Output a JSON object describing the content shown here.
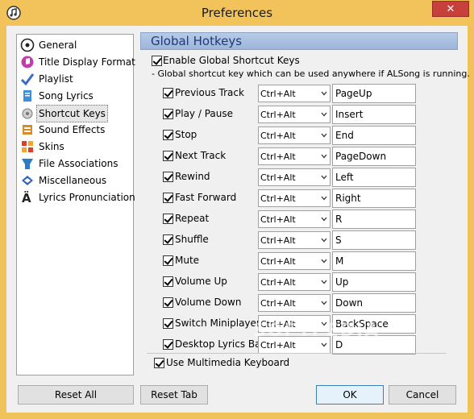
{
  "window": {
    "title": "Preferences",
    "close_label": "✕"
  },
  "sidebar": {
    "items": [
      {
        "label": "General",
        "icon": "general-icon",
        "selected": false
      },
      {
        "label": "Title Display Format",
        "icon": "title-format-icon",
        "selected": false
      },
      {
        "label": "Playlist",
        "icon": "playlist-icon",
        "selected": false
      },
      {
        "label": "Song Lyrics",
        "icon": "lyrics-icon",
        "selected": false
      },
      {
        "label": "Shortcut Keys",
        "icon": "shortcut-keys-icon",
        "selected": true
      },
      {
        "label": "Sound Effects",
        "icon": "sound-effects-icon",
        "selected": false
      },
      {
        "label": "Skins",
        "icon": "skins-icon",
        "selected": false
      },
      {
        "label": "File Associations",
        "icon": "file-associations-icon",
        "selected": false
      },
      {
        "label": "Miscellaneous",
        "icon": "miscellaneous-icon",
        "selected": false
      },
      {
        "label": "Lyrics Pronunciation",
        "icon": "pronunciation-icon",
        "selected": false
      }
    ]
  },
  "panel": {
    "header": "Global Hotkeys",
    "enable_label": "Enable Global Shortcut Keys",
    "enable_checked": true,
    "description": "- Global shortcut key which can be used anywhere if ALSong is running.",
    "hotkeys": [
      {
        "label": "Previous Track",
        "modifier": "Ctrl+Alt",
        "key": "PageUp"
      },
      {
        "label": "Play / Pause",
        "modifier": "Ctrl+Alt",
        "key": "Insert"
      },
      {
        "label": "Stop",
        "modifier": "Ctrl+Alt",
        "key": "End"
      },
      {
        "label": "Next Track",
        "modifier": "Ctrl+Alt",
        "key": "PageDown"
      },
      {
        "label": "Rewind",
        "modifier": "Ctrl+Alt",
        "key": "Left"
      },
      {
        "label": "Fast Forward",
        "modifier": "Ctrl+Alt",
        "key": "Right"
      },
      {
        "label": "Repeat",
        "modifier": "Ctrl+Alt",
        "key": "R"
      },
      {
        "label": "Shuffle",
        "modifier": "Ctrl+Alt",
        "key": "S"
      },
      {
        "label": "Mute",
        "modifier": "Ctrl+Alt",
        "key": "M"
      },
      {
        "label": "Volume Up",
        "modifier": "Ctrl+Alt",
        "key": "Up"
      },
      {
        "label": "Volume Down",
        "modifier": "Ctrl+Alt",
        "key": "Down"
      },
      {
        "label": "Switch Miniplayer",
        "modifier": "Ctrl+Alt",
        "key": "BackSpace"
      },
      {
        "label": "Desktop Lyrics Bar",
        "modifier": "Ctrl+Alt",
        "key": "D"
      }
    ],
    "multimedia_label": "Use Multimedia Keyboard",
    "multimedia_checked": true
  },
  "footer": {
    "reset_all": "Reset All",
    "reset_tab": "Reset Tab",
    "ok": "OK",
    "cancel": "Cancel"
  },
  "watermark": "SOFTPEDIA",
  "colors": {
    "titlebar": "#f2c35b",
    "close": "#c7403b",
    "header_text": "#1f3a78",
    "header_bg": "#9db5da"
  }
}
